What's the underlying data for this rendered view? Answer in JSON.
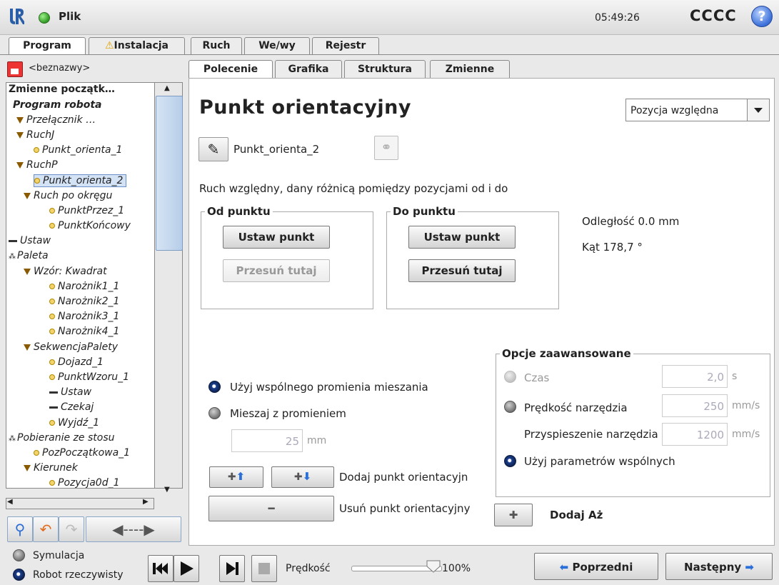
{
  "topbar": {
    "file_menu": "Plik",
    "clock": "05:49:26",
    "robot_name": "CCCC",
    "help_icon": "?"
  },
  "main_tabs": [
    {
      "label": "Program",
      "active": true
    },
    {
      "label": "Instalacja",
      "warning": "⚠"
    },
    {
      "label": "Ruch"
    },
    {
      "label": "We/wy"
    },
    {
      "label": "Rejestr"
    }
  ],
  "left": {
    "program_name": "<beznazwy>",
    "tree": [
      {
        "text": "Zmienne początk…"
      },
      {
        "text": "Program robota"
      },
      {
        "text": "Przełącznik …"
      },
      {
        "text": "RuchJ"
      },
      {
        "text": "Punkt_orienta_1"
      },
      {
        "text": "RuchP"
      },
      {
        "text": "Punkt_orienta_2"
      },
      {
        "text": "Ruch po okręgu"
      },
      {
        "text": "PunktPrzez_1"
      },
      {
        "text": "PunktKońcowy"
      },
      {
        "text": "Ustaw"
      },
      {
        "text": "Paleta"
      },
      {
        "text": "Wzór: Kwadrat"
      },
      {
        "text": "Narożnik1_1"
      },
      {
        "text": "Narożnik2_1"
      },
      {
        "text": "Narożnik3_1"
      },
      {
        "text": "Narożnik4_1"
      },
      {
        "text": "SekwencjaPalety"
      },
      {
        "text": "Dojazd_1"
      },
      {
        "text": "PunktWzoru_1"
      },
      {
        "text": "Ustaw"
      },
      {
        "text": "Czekaj"
      },
      {
        "text": "Wyjdź_1"
      },
      {
        "text": "Pobieranie ze stosu"
      },
      {
        "text": "PozPoczątkowa_1"
      },
      {
        "text": "Kierunek"
      },
      {
        "text": "Pozycja0d_1"
      }
    ]
  },
  "sub_tabs": [
    {
      "label": "Polecenie",
      "active": true
    },
    {
      "label": "Grafika"
    },
    {
      "label": "Struktura"
    },
    {
      "label": "Zmienne"
    }
  ],
  "command": {
    "title": "Punkt orientacyjny",
    "position_select": "Pozycja względna",
    "waypoint_name": "Punkt_orienta_2",
    "description": "Ruch względny, dany różnicą pomiędzy pozycjami od i do",
    "from_group": "Od punktu",
    "to_group": "Do punktu",
    "set_point": "Ustaw punkt",
    "move_here": "Przesuń tutaj",
    "distance": "Odległość 0.0 mm",
    "angle": "Kąt 178,7 °",
    "shared_blend": "Użyj wspólnego promienia mieszania",
    "blend_radius": "Mieszaj z promieniem",
    "blend_value": "25",
    "blend_unit": "mm",
    "add_waypoint": "Dodaj punkt orientacyjn",
    "remove_waypoint": "Usuń punkt orientacyjny",
    "add_until": "Dodaj Aż",
    "advanced": {
      "title": "Opcje zaawansowane",
      "time_label": "Czas",
      "time_value": "2,0",
      "time_unit": "s",
      "tool_speed_label": "Prędkość narzędzia",
      "tool_speed_value": "250",
      "tool_speed_unit": "mm/s",
      "tool_accel_label": "Przyspieszenie narzędzia",
      "tool_accel_value": "1200",
      "tool_accel_unit": "mm/s",
      "shared_params": "Użyj parametrów wspólnych"
    }
  },
  "bottom": {
    "simulation": "Symulacja",
    "real_robot": "Robot rzeczywisty",
    "speed_label": "Prędkość",
    "speed_value": "100%",
    "speed_fraction": 1.0,
    "prev": "Poprzedni",
    "next": "Następny"
  }
}
